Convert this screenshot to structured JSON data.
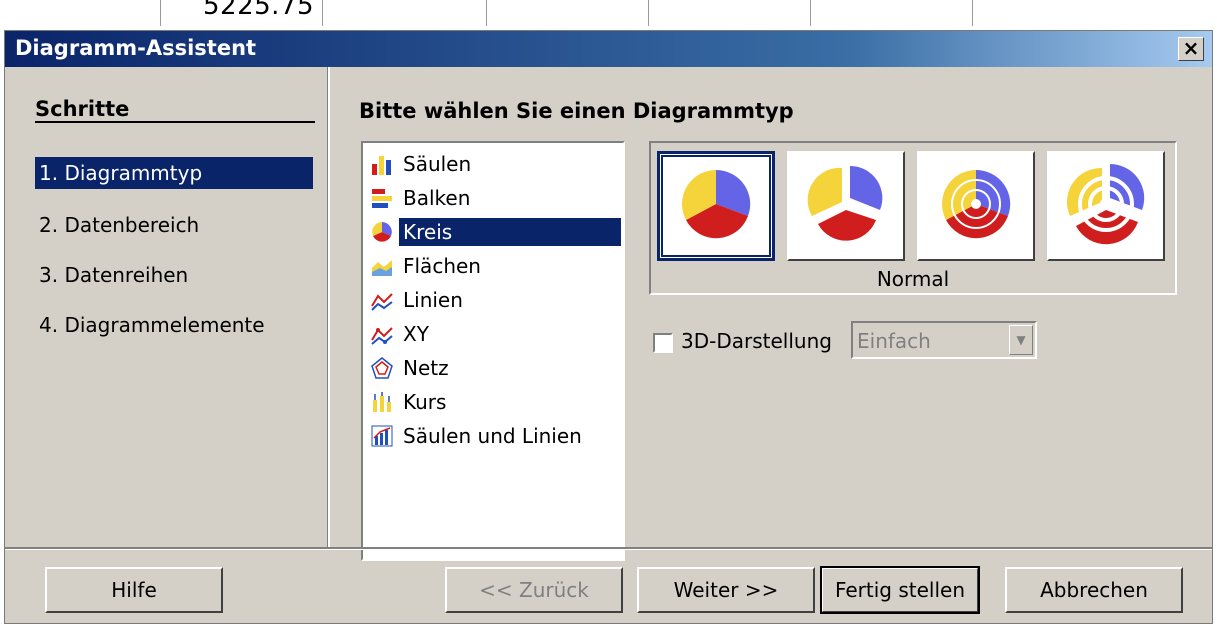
{
  "background": {
    "cell_value": "5225.75"
  },
  "window": {
    "title": "Diagramm-Assistent",
    "close_label": "×"
  },
  "steps": {
    "header": "Schritte",
    "items": [
      {
        "label": "1. Diagrammtyp",
        "active": true
      },
      {
        "label": "2. Datenbereich",
        "active": false
      },
      {
        "label": "3. Datenreihen",
        "active": false
      },
      {
        "label": "4. Diagrammelemente",
        "active": false
      }
    ]
  },
  "content": {
    "header": "Bitte wählen Sie einen Diagrammtyp",
    "chart_types": [
      {
        "label": "Säulen",
        "icon": "column-chart-icon"
      },
      {
        "label": "Balken",
        "icon": "bar-chart-icon"
      },
      {
        "label": "Kreis",
        "icon": "pie-chart-icon",
        "selected": true
      },
      {
        "label": "Flächen",
        "icon": "area-chart-icon"
      },
      {
        "label": "Linien",
        "icon": "line-chart-icon"
      },
      {
        "label": "XY",
        "icon": "xy-chart-icon"
      },
      {
        "label": "Netz",
        "icon": "net-chart-icon"
      },
      {
        "label": "Kurs",
        "icon": "stock-chart-icon"
      },
      {
        "label": "Säulen und Linien",
        "icon": "column-line-chart-icon"
      }
    ],
    "variants": {
      "selected_caption": "Normal",
      "items": [
        "pie-normal-icon",
        "pie-exploded-icon",
        "donut-icon",
        "donut-exploded-icon"
      ]
    },
    "option_3d": {
      "label": "3D-Darstellung",
      "checked": false
    },
    "shape_select": {
      "value": "Einfach",
      "disabled": true
    }
  },
  "buttons": {
    "help": "Hilfe",
    "back": "<< Zurück",
    "next": "Weiter >>",
    "finish": "Fertig stellen",
    "cancel": "Abbrechen"
  },
  "colors": {
    "title_bar": "#0a246a",
    "selection": "#0a246a",
    "dialog_face": "#d4d0c8",
    "pie_yellow": "#f5d33a",
    "pie_blue": "#6464e6",
    "pie_red": "#d01d1d"
  }
}
